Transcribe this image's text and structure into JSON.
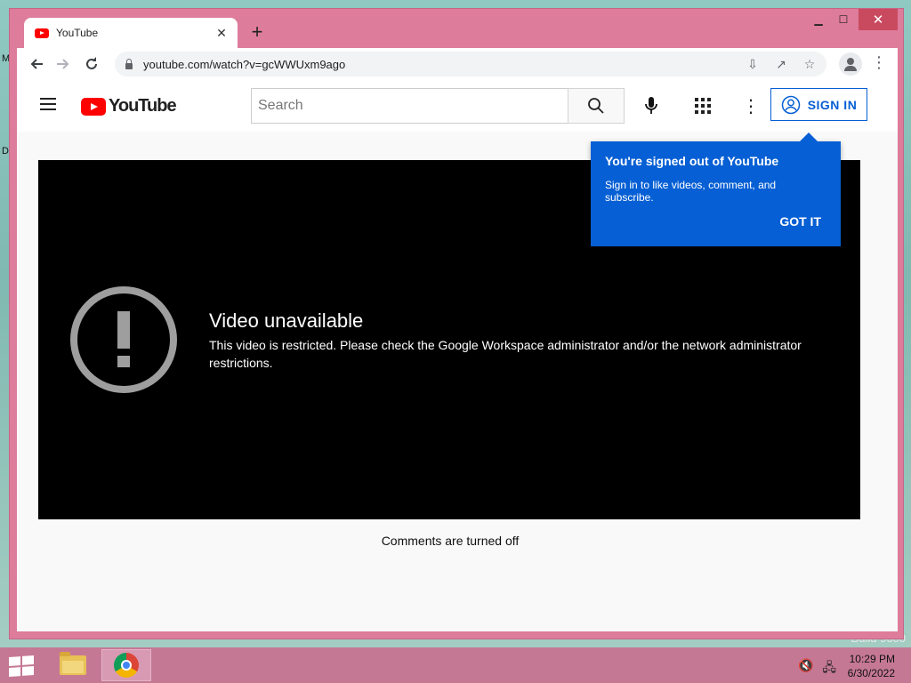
{
  "desktop": {
    "left_letters": [
      "M",
      "D"
    ],
    "watermark": "Build 9600"
  },
  "browser": {
    "tab_title": "YouTube",
    "url": "youtube.com/watch?v=gcWWUxm9ago",
    "window_controls": {
      "minimize": "▁",
      "maximize": "☐",
      "close": "✕"
    }
  },
  "youtube": {
    "logo_text": "YouTube",
    "search_placeholder": "Search",
    "sign_in_label": "SIGN IN",
    "player": {
      "error_title": "Video unavailable",
      "error_message": "This video is restricted. Please check the Google Workspace administrator and/or the network administrator restrictions."
    },
    "comments_text": "Comments are turned off",
    "tooltip": {
      "title": "You're signed out of YouTube",
      "body": "Sign in to like videos, comment, and subscribe.",
      "action": "GOT IT"
    },
    "accent_color": "#065fd4",
    "brand_color": "#ff0000"
  },
  "taskbar": {
    "time": "10:29 PM",
    "date": "6/30/2022",
    "pinned": [
      "file-explorer-icon",
      "chrome-icon"
    ]
  }
}
